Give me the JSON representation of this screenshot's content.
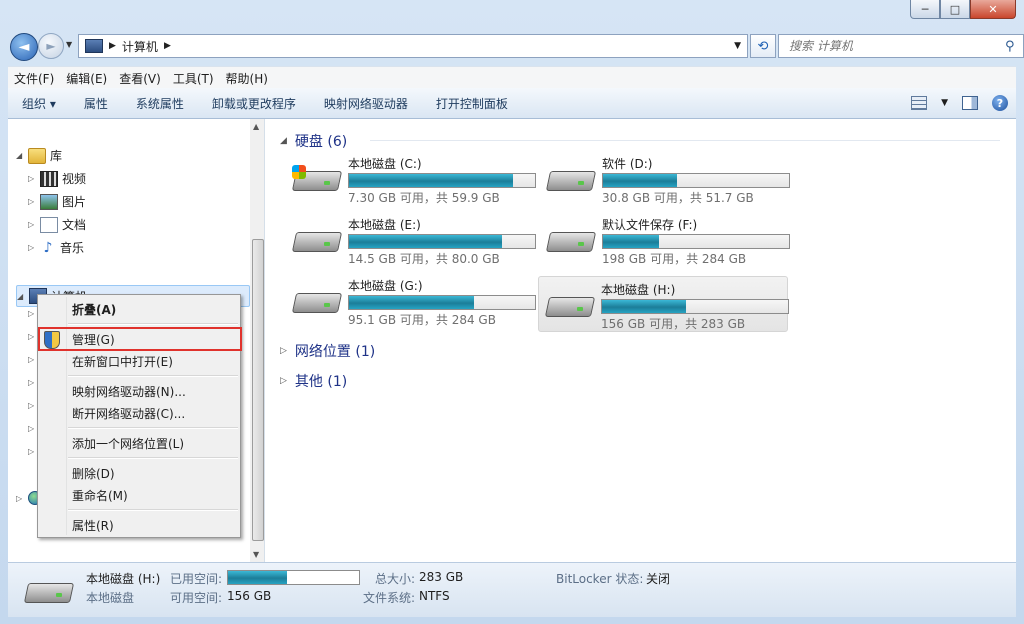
{
  "window": {
    "minimize": "─",
    "maximize": "□",
    "close": "✕"
  },
  "nav": {
    "back": "◄",
    "forward": "►",
    "history_dd": "▼",
    "breadcrumb": "计算机",
    "refresh": "⟲",
    "search_placeholder": "搜索 计算机",
    "search_icon": "⚲"
  },
  "menu": [
    "文件(F)",
    "编辑(E)",
    "查看(V)",
    "工具(T)",
    "帮助(H)"
  ],
  "commands": [
    "组织 ▾",
    "属性",
    "系统属性",
    "卸载或更改程序",
    "映射网络驱动器",
    "打开控制面板"
  ],
  "cmd_right": {
    "view_dd": "▼",
    "help": "?"
  },
  "tree": {
    "library": "库",
    "video": "视频",
    "pictures": "图片",
    "docs": "文档",
    "music": "音乐",
    "computer": "计算机"
  },
  "context_menu": {
    "collapse": "折叠(A)",
    "manage": "管理(G)",
    "open_new": "在新窗口中打开(E)",
    "map_drive": "映射网络驱动器(N)...",
    "disconnect": "断开网络驱动器(C)...",
    "add_location": "添加一个网络位置(L)",
    "delete": "删除(D)",
    "rename": "重命名(M)",
    "properties": "属性(R)"
  },
  "groups": {
    "hdd": "硬盘 (6)",
    "network": "网络位置 (1)",
    "other": "其他 (1)"
  },
  "drives": [
    {
      "name": "本地磁盘 (C:)",
      "info": "7.30 GB 可用，共 59.9 GB",
      "used_pct": 88,
      "system": true
    },
    {
      "name": "软件 (D:)",
      "info": "30.8 GB 可用，共 51.7 GB",
      "used_pct": 40,
      "system": false
    },
    {
      "name": "本地磁盘 (E:)",
      "info": "14.5 GB 可用，共 80.0 GB",
      "used_pct": 82,
      "system": false
    },
    {
      "name": "默认文件保存 (F:)",
      "info": "198 GB 可用，共 284 GB",
      "used_pct": 30,
      "system": false
    },
    {
      "name": "本地磁盘 (G:)",
      "info": "95.1 GB 可用，共 284 GB",
      "used_pct": 67,
      "system": false
    },
    {
      "name": "本地磁盘 (H:)",
      "info": "156 GB 可用，共 283 GB",
      "used_pct": 45,
      "system": false
    }
  ],
  "details": {
    "name": "本地磁盘 (H:)",
    "type": "本地磁盘",
    "used_label": "已用空间:",
    "used_pct": 45,
    "free_label": "可用空间:",
    "free_value": "156 GB",
    "total_label": "总大小:",
    "total_value": "283 GB",
    "fs_label": "文件系统:",
    "fs_value": "NTFS",
    "bitlocker_label": "BitLocker 状态:",
    "bitlocker_value": "关闭"
  }
}
